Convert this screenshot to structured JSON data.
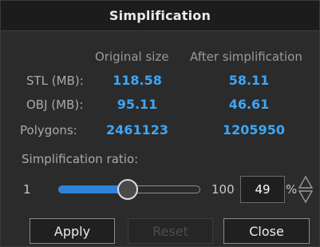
{
  "window": {
    "title": "Simplification"
  },
  "columns": {
    "original": "Original size",
    "after": "After simplification"
  },
  "rows": [
    {
      "label": "STL (MB):",
      "original": "118.58",
      "after": "58.11"
    },
    {
      "label": "OBJ (MB):",
      "original": "95.11",
      "after": "46.61"
    },
    {
      "label": "Polygons:",
      "original": "2461123",
      "after": "1205950"
    }
  ],
  "ratio": {
    "label": "Simplification ratio:",
    "min": "1",
    "max": "100",
    "value": "49",
    "unit": "%",
    "slider_fraction": 0.49
  },
  "buttons": {
    "apply": "Apply",
    "reset": "Reset",
    "close": "Close"
  },
  "colors": {
    "accent": "#3ea6f5",
    "background": "#2b2b2b",
    "titlebar": "#1c1c1c"
  },
  "icons": {
    "spinner": "up-down-arrows-icon"
  }
}
